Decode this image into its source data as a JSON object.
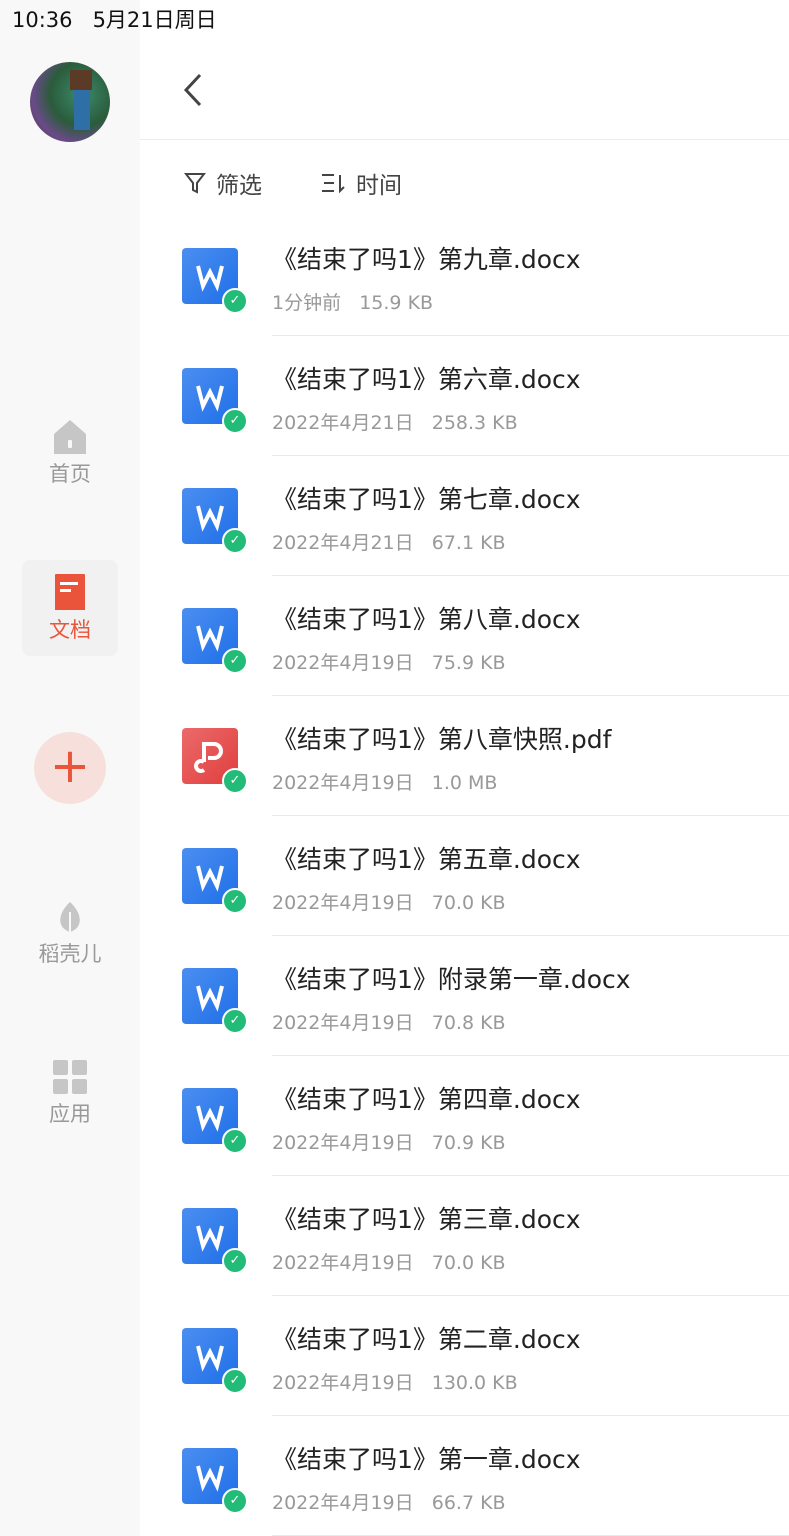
{
  "status_bar": {
    "time": "10:36",
    "date": "5月21日周日"
  },
  "sidebar": {
    "items": [
      {
        "label": "首页",
        "icon": "home-icon"
      },
      {
        "label": "文档",
        "icon": "document-icon",
        "active": true
      },
      {
        "label": "稻壳儿",
        "icon": "leaf-icon"
      },
      {
        "label": "应用",
        "icon": "apps-grid-icon"
      }
    ],
    "add_label": "+"
  },
  "toolbar": {
    "filter_label": "筛选",
    "sort_label": "时间"
  },
  "colors": {
    "accent": "#e9543a",
    "word": "#2f7ff0",
    "pdf": "#e64848",
    "synced": "#22bb77"
  },
  "files": [
    {
      "name": "《结束了吗1》第九章.docx",
      "time": "1分钟前",
      "size": "15.9 KB",
      "type": "word"
    },
    {
      "name": "《结束了吗1》第六章.docx",
      "time": "2022年4月21日",
      "size": "258.3 KB",
      "type": "word"
    },
    {
      "name": "《结束了吗1》第七章.docx",
      "time": "2022年4月21日",
      "size": "67.1 KB",
      "type": "word"
    },
    {
      "name": "《结束了吗1》第八章.docx",
      "time": "2022年4月19日",
      "size": "75.9 KB",
      "type": "word"
    },
    {
      "name": "《结束了吗1》第八章快照.pdf",
      "time": "2022年4月19日",
      "size": "1.0 MB",
      "type": "pdf"
    },
    {
      "name": "《结束了吗1》第五章.docx",
      "time": "2022年4月19日",
      "size": "70.0 KB",
      "type": "word"
    },
    {
      "name": "《结束了吗1》附录第一章.docx",
      "time": "2022年4月19日",
      "size": "70.8 KB",
      "type": "word"
    },
    {
      "name": "《结束了吗1》第四章.docx",
      "time": "2022年4月19日",
      "size": "70.9 KB",
      "type": "word"
    },
    {
      "name": "《结束了吗1》第三章.docx",
      "time": "2022年4月19日",
      "size": "70.0 KB",
      "type": "word"
    },
    {
      "name": "《结束了吗1》第二章.docx",
      "time": "2022年4月19日",
      "size": "130.0 KB",
      "type": "word"
    },
    {
      "name": "《结束了吗1》第一章.docx",
      "time": "2022年4月19日",
      "size": "66.7 KB",
      "type": "word"
    }
  ]
}
